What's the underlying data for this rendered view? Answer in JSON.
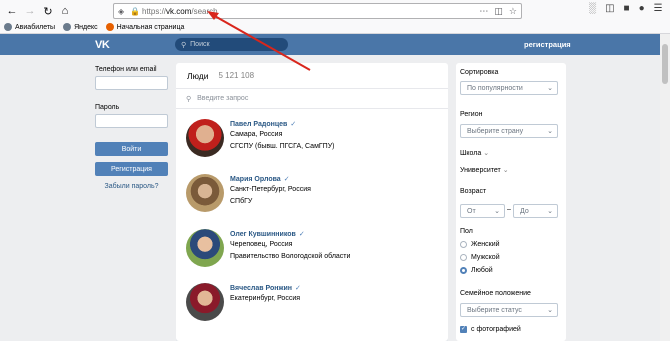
{
  "browser": {
    "url_prefix": "https://",
    "url_host": "vk.com",
    "url_path": "/search",
    "bookmarks": [
      "Авиабилеты",
      "Яндекс",
      "Начальная страница"
    ]
  },
  "vk": {
    "search_placeholder": "Поиск",
    "register_link": "регистрация"
  },
  "login": {
    "phone_label": "Телефон или email",
    "password_label": "Пароль",
    "login_button": "Войти",
    "register_button": "Регистрация",
    "forgot_link": "Забыли пароль?"
  },
  "results": {
    "title": "Люди",
    "count": "5 121 108",
    "search_placeholder": "Введите запрос",
    "people": [
      {
        "name": "Павел Радонцев",
        "city": "Самара, Россия",
        "info": "СГСПУ (бывш. ПГСГА, СамГПУ)"
      },
      {
        "name": "Мария Орлова",
        "city": "Санкт-Петербург, Россия",
        "info": "СПбГУ"
      },
      {
        "name": "Олег Кувшинников",
        "city": "Череповец, Россия",
        "info": "Правительство Вологодской области"
      },
      {
        "name": "Вячеслав Ронжин",
        "city": "Екатеринбург, Россия",
        "info": ""
      }
    ]
  },
  "filters": {
    "sort_label": "Сортировка",
    "sort_value": "По популярности",
    "region_label": "Регион",
    "region_value": "Выберите страну",
    "school_label": "Школа",
    "university_label": "Университет",
    "age_label": "Возраст",
    "age_from": "От",
    "age_dash": "–",
    "age_to": "До",
    "sex_label": "Пол",
    "sex_female": "Женский",
    "sex_male": "Мужской",
    "sex_any": "Любой",
    "marital_label": "Семейное положение",
    "marital_value": "Выберите статус",
    "with_photo": "с фотографией"
  }
}
